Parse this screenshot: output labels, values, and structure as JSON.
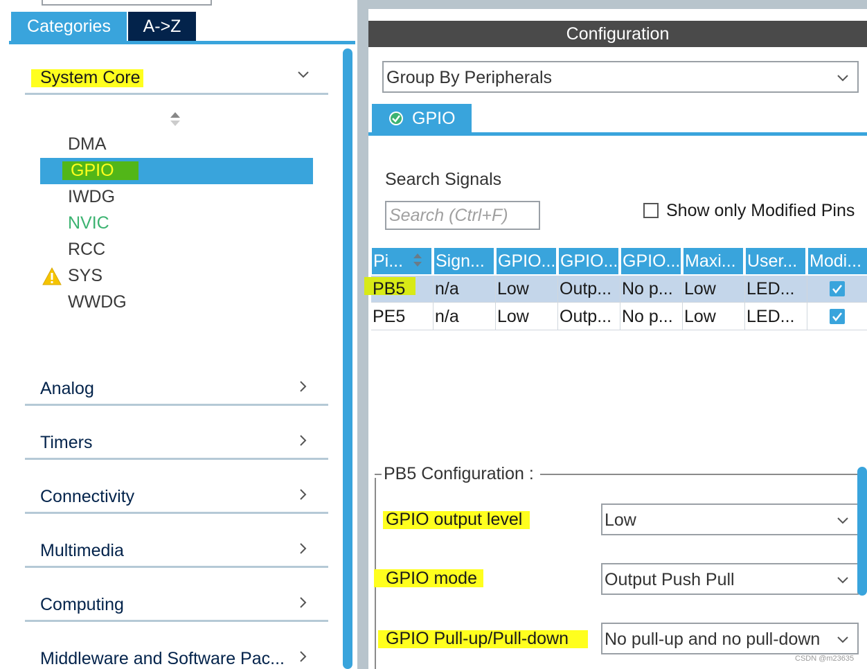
{
  "left_panel": {
    "tabs": {
      "categories": "Categories",
      "az": "A->Z"
    },
    "categories": [
      {
        "label": "System Core",
        "expanded": true
      },
      {
        "label": "Analog"
      },
      {
        "label": "Timers"
      },
      {
        "label": "Connectivity"
      },
      {
        "label": "Multimedia"
      },
      {
        "label": "Computing"
      },
      {
        "label": "Middleware and Software Pac..."
      }
    ],
    "system_core_items": [
      "DMA",
      "GPIO",
      "IWDG",
      "NVIC",
      "RCC",
      "SYS",
      "WWDG"
    ],
    "selected_item": "GPIO"
  },
  "configuration": {
    "header": "Configuration",
    "group_by": "Group By Peripherals",
    "tab_label": "GPIO",
    "search_title": "Search Signals",
    "search_placeholder": "Search (Ctrl+F)",
    "show_modified_label": "Show only Modified Pins",
    "table": {
      "columns": [
        "Pi...",
        "Sign...",
        "GPIO...",
        "GPIO...",
        "GPIO...",
        "Maxi...",
        "User...",
        "Modi..."
      ],
      "rows": [
        {
          "pin": "PB5",
          "signal": "n/a",
          "output_level": "Low",
          "mode": "Outp...",
          "pull": "No p...",
          "max_speed": "Low",
          "user_label": "LED...",
          "modified": true
        },
        {
          "pin": "PE5",
          "signal": "n/a",
          "output_level": "Low",
          "mode": "Outp...",
          "pull": "No p...",
          "max_speed": "Low",
          "user_label": "LED...",
          "modified": true
        }
      ]
    },
    "pin_config": {
      "title": "PB5 Configuration :",
      "fields": [
        {
          "label": "GPIO output level",
          "value": "Low"
        },
        {
          "label": "GPIO mode",
          "value": "Output Push Pull"
        },
        {
          "label": "GPIO Pull-up/Pull-down",
          "value": "No pull-up and no pull-down"
        }
      ]
    },
    "watermark": "CSDN @m23635"
  },
  "colors": {
    "accent_blue": "#39a4dc",
    "dark_navy": "#03234b",
    "header_gray": "#4a4a4a",
    "highlight_yellow": "#ffff1e",
    "highlight_green": "#52b618",
    "nvic_green": "#3cb371",
    "selected_row": "#c4d6ea"
  }
}
